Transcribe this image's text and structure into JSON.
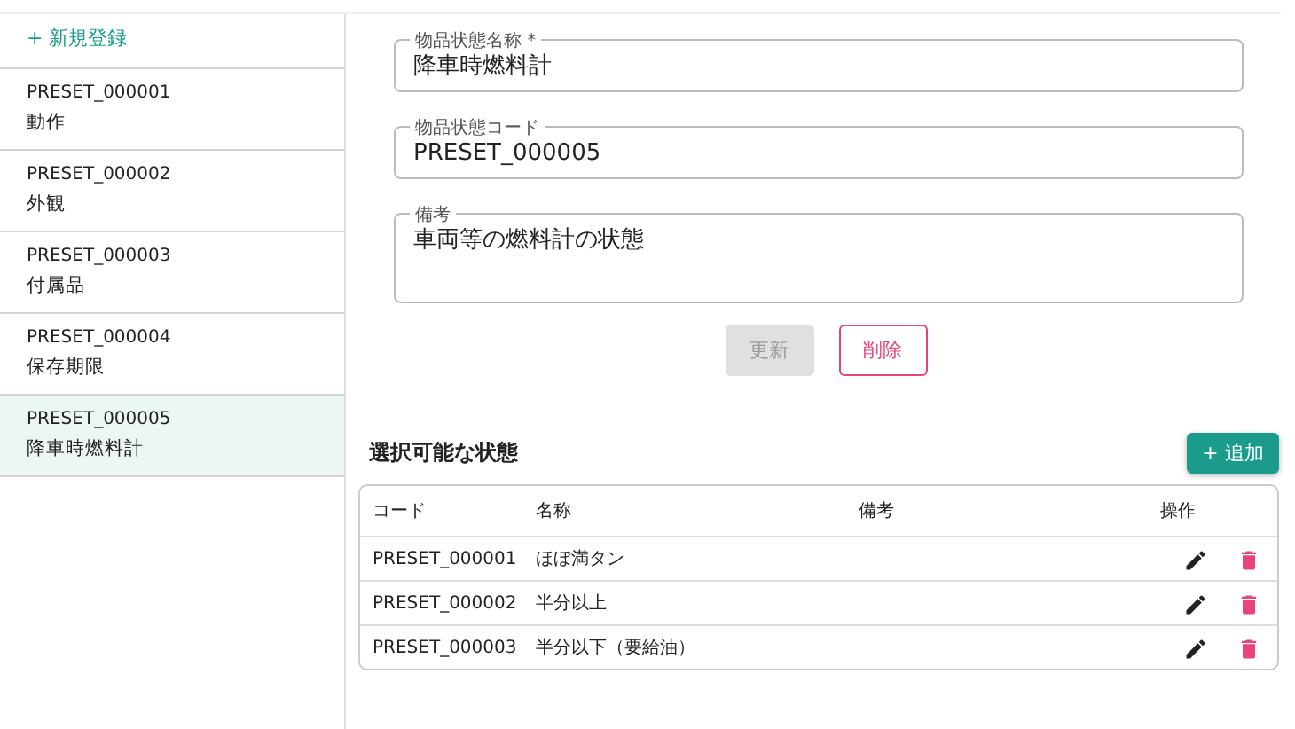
{
  "sidebar": {
    "new_link": "+ 新規登録",
    "items": [
      {
        "code": "PRESET_000001",
        "name": "動作",
        "selected": false
      },
      {
        "code": "PRESET_000002",
        "name": "外観",
        "selected": false
      },
      {
        "code": "PRESET_000003",
        "name": "付属品",
        "selected": false
      },
      {
        "code": "PRESET_000004",
        "name": "保存期限",
        "selected": false
      },
      {
        "code": "PRESET_000005",
        "name": "降車時燃料計",
        "selected": true
      }
    ]
  },
  "form": {
    "fields": [
      {
        "label": "物品状態名称 *",
        "value": "降車時燃料計",
        "kind": "input"
      },
      {
        "label": "物品状態コード",
        "value": "PRESET_000005",
        "kind": "input"
      },
      {
        "label": "備考",
        "value": "車両等の燃料計の状態",
        "kind": "textarea"
      }
    ],
    "buttons": [
      {
        "label": "更新",
        "kind": "primary",
        "disabled": true
      },
      {
        "label": "削除",
        "kind": "danger",
        "disabled": false
      }
    ]
  },
  "states": {
    "title": "選択可能な状態",
    "add_button": "+ 追加",
    "columns": [
      "コード",
      "名称",
      "備考",
      "操作"
    ],
    "rows": [
      {
        "code": "PRESET_000001",
        "name": "ほぼ満タン"
      },
      {
        "code": "PRESET_000002",
        "name": "半分以上"
      },
      {
        "code": "PRESET_000003",
        "name": "半分以下（要給油）"
      }
    ]
  }
}
